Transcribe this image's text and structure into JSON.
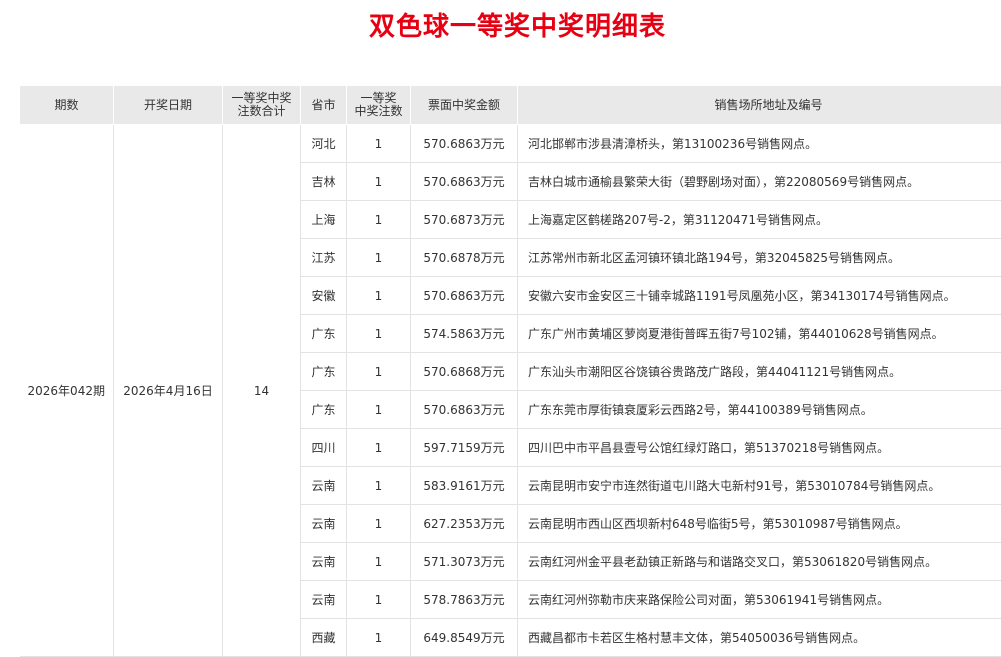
{
  "title": "双色球一等奖中奖明细表",
  "table": {
    "headers": {
      "period": "期数",
      "date": "开奖日期",
      "total_line1": "一等奖中奖",
      "total_line2": "注数合计",
      "province": "省市",
      "count_line1": "一等奖",
      "count_line2": "中奖注数",
      "amount": "票面中奖金额",
      "address": "销售场所地址及编号"
    },
    "period": "2026年042期",
    "draw_date": "2026年4月16日",
    "total_winners": "14",
    "rows": [
      {
        "province": "河北",
        "count": "1",
        "amount": "570.6863万元",
        "address": "河北邯郸市涉县清漳桥头，第13100236号销售网点。"
      },
      {
        "province": "吉林",
        "count": "1",
        "amount": "570.6863万元",
        "address": "吉林白城市通榆县繁荣大街（碧野剧场对面），第22080569号销售网点。"
      },
      {
        "province": "上海",
        "count": "1",
        "amount": "570.6873万元",
        "address": "上海嘉定区鹤槎路207号-2，第31120471号销售网点。"
      },
      {
        "province": "江苏",
        "count": "1",
        "amount": "570.6878万元",
        "address": "江苏常州市新北区孟河镇环镇北路194号，第32045825号销售网点。"
      },
      {
        "province": "安徽",
        "count": "1",
        "amount": "570.6863万元",
        "address": "安徽六安市金安区三十铺幸城路1191号凤凰苑小区，第34130174号销售网点。"
      },
      {
        "province": "广东",
        "count": "1",
        "amount": "574.5863万元",
        "address": "广东广州市黄埔区萝岗夏港街普晖五街7号102铺，第44010628号销售网点。"
      },
      {
        "province": "广东",
        "count": "1",
        "amount": "570.6868万元",
        "address": "广东汕头市潮阳区谷饶镇谷贵路茂广路段，第44041121号销售网点。"
      },
      {
        "province": "广东",
        "count": "1",
        "amount": "570.6863万元",
        "address": "广东东莞市厚街镇衰厦彩云西路2号，第44100389号销售网点。"
      },
      {
        "province": "四川",
        "count": "1",
        "amount": "597.7159万元",
        "address": "四川巴中市平昌县壹号公馆红绿灯路口，第51370218号销售网点。"
      },
      {
        "province": "云南",
        "count": "1",
        "amount": "583.9161万元",
        "address": "云南昆明市安宁市连然街道屯川路大屯新村91号，第53010784号销售网点。"
      },
      {
        "province": "云南",
        "count": "1",
        "amount": "627.2353万元",
        "address": "云南昆明市西山区西坝新村648号临街5号，第53010987号销售网点。"
      },
      {
        "province": "云南",
        "count": "1",
        "amount": "571.3073万元",
        "address": "云南红河州金平县老勐镇正新路与和谐路交叉口，第53061820号销售网点。"
      },
      {
        "province": "云南",
        "count": "1",
        "amount": "578.7863万元",
        "address": "云南红河州弥勒市庆来路保险公司对面，第53061941号销售网点。"
      },
      {
        "province": "西藏",
        "count": "1",
        "amount": "649.8549万元",
        "address": "西藏昌都市卡若区生格村慧丰文体，第54050036号销售网点。"
      }
    ]
  }
}
